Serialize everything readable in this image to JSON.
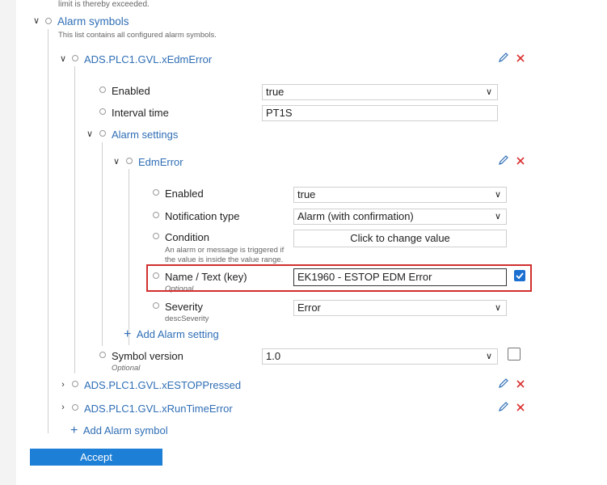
{
  "top_hint": "limit is thereby exceeded.",
  "alarm_symbols": {
    "title": "Alarm symbols",
    "description": "This list contains all configured alarm symbols.",
    "symbol1": {
      "name": "ADS.PLC1.GVL.xEdmError",
      "enabled_label": "Enabled",
      "enabled_value": "true",
      "interval_label": "Interval time",
      "interval_value": "PT1S",
      "alarm_settings_title": "Alarm settings",
      "setting": {
        "name": "EdmError",
        "enabled_label": "Enabled",
        "enabled_value": "true",
        "notification_label": "Notification type",
        "notification_value": "Alarm (with confirmation)",
        "condition_label": "Condition",
        "condition_hint_1": "An alarm or message is triggered if",
        "condition_hint_2": "the value is inside the value range.",
        "condition_button": "Click to change value",
        "name_label": "Name / Text (key)",
        "name_hint": "Optional",
        "name_value": "EK1960 - ESTOP EDM Error",
        "name_checked": true,
        "severity_label": "Severity",
        "severity_hint": "descSeverity",
        "severity_value": "Error"
      },
      "add_setting": "Add Alarm setting",
      "symbol_version_label": "Symbol version",
      "symbol_version_hint": "Optional",
      "symbol_version_value": "1.0",
      "symbol_version_checked": false
    },
    "symbol2": {
      "name": "ADS.PLC1.GVL.xESTOPPressed"
    },
    "symbol3": {
      "name": "ADS.PLC1.GVL.xRunTimeError"
    },
    "add_symbol": "Add Alarm symbol"
  },
  "accept_label": "Accept",
  "colors": {
    "link": "#2f6eb5",
    "accept_bg": "#1e7fd6",
    "highlight_border": "#d12f2f",
    "delete_x": "#d9302f"
  }
}
